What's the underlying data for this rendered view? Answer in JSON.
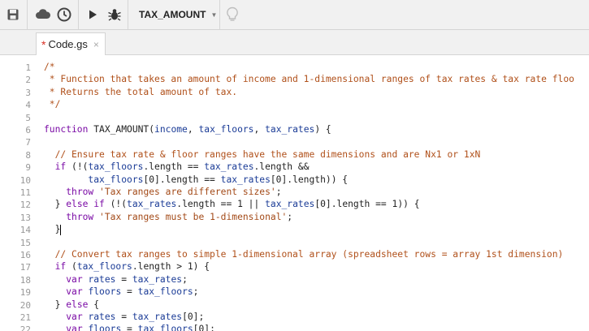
{
  "toolbar": {
    "function_select_label": "TAX_AMOUNT",
    "icons": [
      "save-icon",
      "cloud-icon",
      "clock-icon",
      "run-icon",
      "debug-icon",
      "lightbulb-icon"
    ]
  },
  "tabs": [
    {
      "label": "Code.gs",
      "modified_marker": "*",
      "close": "×"
    }
  ],
  "editor": {
    "line_numbers": [
      "1",
      "2",
      "3",
      "4",
      "5",
      "6",
      "7",
      "8",
      "9",
      "10",
      "11",
      "12",
      "13",
      "14",
      "15",
      "16",
      "17",
      "18",
      "19",
      "20",
      "21",
      "22"
    ],
    "lines": [
      [
        {
          "t": "/*",
          "c": "c"
        }
      ],
      [
        {
          "t": " * Function that takes an amount of income and 1-dimensional ranges of tax rates & tax rate floo",
          "c": "c"
        }
      ],
      [
        {
          "t": " * Returns the total amount of tax.",
          "c": "c"
        }
      ],
      [
        {
          "t": " */",
          "c": "c"
        }
      ],
      [],
      [
        {
          "t": "function",
          "c": "k"
        },
        {
          "t": " TAX_AMOUNT(",
          "c": ""
        },
        {
          "t": "income",
          "c": "v"
        },
        {
          "t": ", ",
          "c": ""
        },
        {
          "t": "tax_floors",
          "c": "v"
        },
        {
          "t": ", ",
          "c": ""
        },
        {
          "t": "tax_rates",
          "c": "v"
        },
        {
          "t": ") {",
          "c": ""
        }
      ],
      [],
      [
        {
          "t": "  // Ensure tax rate & floor ranges have the same dimensions and are Nx1 or 1xN",
          "c": "c"
        }
      ],
      [
        {
          "t": "  ",
          "c": ""
        },
        {
          "t": "if",
          "c": "k"
        },
        {
          "t": " (!(",
          "c": ""
        },
        {
          "t": "tax_floors",
          "c": "v"
        },
        {
          "t": ".length == ",
          "c": ""
        },
        {
          "t": "tax_rates",
          "c": "v"
        },
        {
          "t": ".length &&",
          "c": ""
        }
      ],
      [
        {
          "t": "        ",
          "c": ""
        },
        {
          "t": "tax_floors",
          "c": "v"
        },
        {
          "t": "[0].length == ",
          "c": ""
        },
        {
          "t": "tax_rates",
          "c": "v"
        },
        {
          "t": "[0].length)) {",
          "c": ""
        }
      ],
      [
        {
          "t": "    ",
          "c": ""
        },
        {
          "t": "throw",
          "c": "k"
        },
        {
          "t": " ",
          "c": ""
        },
        {
          "t": "'Tax ranges are different sizes'",
          "c": "s"
        },
        {
          "t": ";",
          "c": ""
        }
      ],
      [
        {
          "t": "  } ",
          "c": ""
        },
        {
          "t": "else if",
          "c": "k"
        },
        {
          "t": " (!(",
          "c": ""
        },
        {
          "t": "tax_rates",
          "c": "v"
        },
        {
          "t": ".length == 1 || ",
          "c": ""
        },
        {
          "t": "tax_rates",
          "c": "v"
        },
        {
          "t": "[0].length == 1)) {",
          "c": ""
        }
      ],
      [
        {
          "t": "    ",
          "c": ""
        },
        {
          "t": "throw",
          "c": "k"
        },
        {
          "t": " ",
          "c": ""
        },
        {
          "t": "'Tax ranges must be 1-dimensional'",
          "c": "s"
        },
        {
          "t": ";",
          "c": ""
        }
      ],
      [
        {
          "t": "  }",
          "c": ""
        }
      ],
      [],
      [
        {
          "t": "  // Convert tax ranges to simple 1-dimensional array (spreadsheet rows = array 1st dimension)",
          "c": "c"
        }
      ],
      [
        {
          "t": "  ",
          "c": ""
        },
        {
          "t": "if",
          "c": "k"
        },
        {
          "t": " (",
          "c": ""
        },
        {
          "t": "tax_floors",
          "c": "v"
        },
        {
          "t": ".length > 1) {",
          "c": ""
        }
      ],
      [
        {
          "t": "    ",
          "c": ""
        },
        {
          "t": "var",
          "c": "k"
        },
        {
          "t": " ",
          "c": ""
        },
        {
          "t": "rates",
          "c": "v"
        },
        {
          "t": " = ",
          "c": ""
        },
        {
          "t": "tax_rates",
          "c": "v"
        },
        {
          "t": ";",
          "c": ""
        }
      ],
      [
        {
          "t": "    ",
          "c": ""
        },
        {
          "t": "var",
          "c": "k"
        },
        {
          "t": " ",
          "c": ""
        },
        {
          "t": "floors",
          "c": "v"
        },
        {
          "t": " = ",
          "c": ""
        },
        {
          "t": "tax_floors",
          "c": "v"
        },
        {
          "t": ";",
          "c": ""
        }
      ],
      [
        {
          "t": "  } ",
          "c": ""
        },
        {
          "t": "else",
          "c": "k"
        },
        {
          "t": " {",
          "c": ""
        }
      ],
      [
        {
          "t": "    ",
          "c": ""
        },
        {
          "t": "var",
          "c": "k"
        },
        {
          "t": " ",
          "c": ""
        },
        {
          "t": "rates",
          "c": "v"
        },
        {
          "t": " = ",
          "c": ""
        },
        {
          "t": "tax_rates",
          "c": "v"
        },
        {
          "t": "[0];",
          "c": ""
        }
      ],
      [
        {
          "t": "    ",
          "c": ""
        },
        {
          "t": "var",
          "c": "k"
        },
        {
          "t": " ",
          "c": ""
        },
        {
          "t": "floors",
          "c": "v"
        },
        {
          "t": " = ",
          "c": ""
        },
        {
          "t": "tax_floors",
          "c": "v"
        },
        {
          "t": "[0];",
          "c": ""
        }
      ]
    ],
    "cursor_line": 14
  }
}
